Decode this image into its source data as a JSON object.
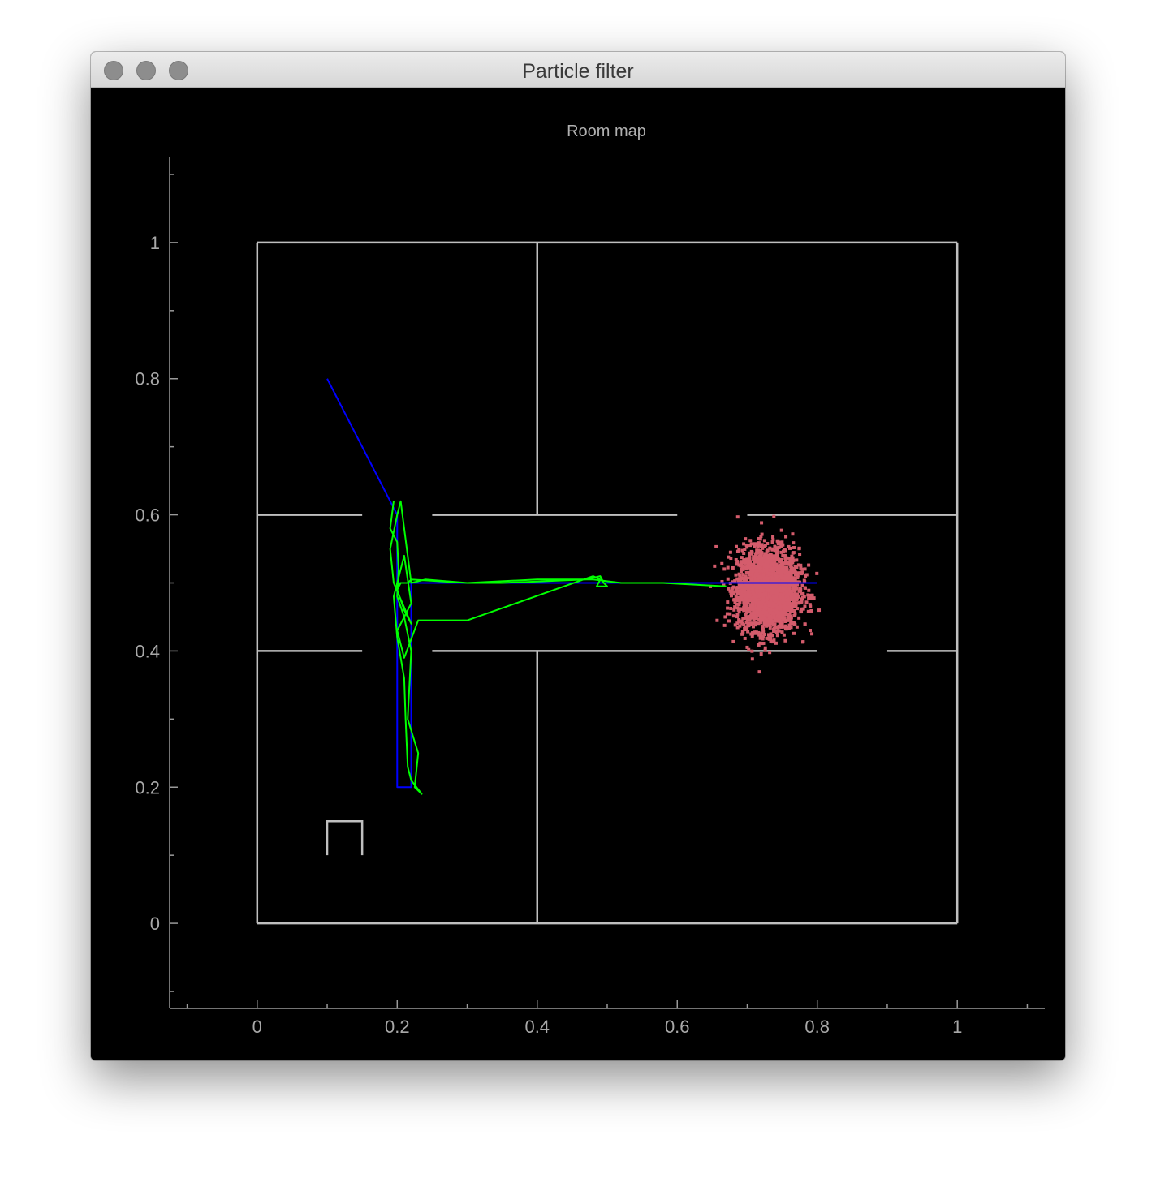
{
  "window": {
    "title": "Particle filter"
  },
  "colors": {
    "background": "#000000",
    "axis": "#9a9a9a",
    "walls": "#bfbfbf",
    "true_path": "#0000ff",
    "estimated_path": "#00ff00",
    "particles": "#d45c6c"
  },
  "chart_data": {
    "type": "line",
    "title": "Room map",
    "xlabel": "",
    "ylabel": "",
    "xlim": [
      -0.125,
      1.125
    ],
    "ylim": [
      -0.125,
      1.125
    ],
    "xticks": [
      0,
      0.2,
      0.4,
      0.6,
      0.8,
      1
    ],
    "yticks": [
      0,
      0.2,
      0.4,
      0.6,
      0.8,
      1
    ],
    "xtick_labels": [
      "0",
      "0.2",
      "0.4",
      "0.6",
      "0.8",
      "1"
    ],
    "ytick_labels": [
      "0",
      "0.2",
      "0.4",
      "0.6",
      "0.8",
      "1"
    ],
    "grid": false,
    "walls": [
      {
        "x": [
          0,
          1
        ],
        "y": [
          0,
          0
        ]
      },
      {
        "x": [
          1,
          1
        ],
        "y": [
          0,
          1
        ]
      },
      {
        "x": [
          1,
          0
        ],
        "y": [
          1,
          1
        ]
      },
      {
        "x": [
          0,
          0
        ],
        "y": [
          1,
          0
        ]
      },
      {
        "x": [
          0.4,
          0.4
        ],
        "y": [
          1,
          0.6
        ]
      },
      {
        "x": [
          0.4,
          0.4
        ],
        "y": [
          0.4,
          0
        ]
      },
      {
        "x": [
          0,
          0.15
        ],
        "y": [
          0.6,
          0.6
        ]
      },
      {
        "x": [
          0.25,
          0.6
        ],
        "y": [
          0.6,
          0.6
        ]
      },
      {
        "x": [
          0.7,
          1
        ],
        "y": [
          0.6,
          0.6
        ]
      },
      {
        "x": [
          0,
          0.15
        ],
        "y": [
          0.4,
          0.4
        ]
      },
      {
        "x": [
          0.25,
          0.8
        ],
        "y": [
          0.4,
          0.4
        ]
      },
      {
        "x": [
          0.9,
          1
        ],
        "y": [
          0.4,
          0.4
        ]
      },
      {
        "x": [
          0.1,
          0.1,
          0.15,
          0.15
        ],
        "y": [
          0.1,
          0.15,
          0.15,
          0.1
        ]
      }
    ],
    "series": [
      {
        "x": [
          0.1,
          0.2,
          0.2,
          0.22,
          0.22,
          0.2,
          0.22,
          0.49,
          0.66,
          0.8
        ],
        "y": [
          0.8,
          0.6,
          0.2,
          0.2,
          0.5,
          0.5,
          0.5,
          0.5,
          0.5,
          0.5
        ]
      },
      {
        "x": [
          0.195,
          0.19,
          0.2,
          0.202,
          0.2,
          0.21,
          0.22,
          0.215,
          0.23,
          0.225,
          0.235,
          0.22,
          0.215,
          0.212,
          0.21,
          0.2,
          0.195,
          0.21,
          0.22,
          0.2,
          0.21,
          0.23,
          0.3,
          0.48,
          0.49,
          0.485,
          0.5,
          0.495,
          0.49,
          0.47,
          0.35,
          0.3,
          0.22,
          0.215,
          0.205,
          0.2,
          0.21,
          0.22,
          0.195,
          0.19,
          0.2,
          0.205,
          0.22,
          0.24,
          0.3,
          0.4,
          0.48,
          0.52,
          0.58,
          0.67
        ],
        "y": [
          0.62,
          0.58,
          0.56,
          0.52,
          0.48,
          0.45,
          0.4,
          0.3,
          0.25,
          0.2,
          0.19,
          0.21,
          0.23,
          0.3,
          0.36,
          0.42,
          0.48,
          0.54,
          0.47,
          0.43,
          0.39,
          0.445,
          0.445,
          0.51,
          0.505,
          0.495,
          0.495,
          0.5,
          0.51,
          0.505,
          0.5,
          0.5,
          0.505,
          0.5,
          0.5,
          0.49,
          0.46,
          0.44,
          0.5,
          0.55,
          0.6,
          0.62,
          0.5,
          0.505,
          0.5,
          0.505,
          0.505,
          0.5,
          0.5,
          0.495
        ]
      }
    ],
    "particles": {
      "center": [
        0.73,
        0.49
      ],
      "spread": [
        0.022,
        0.03
      ],
      "count": 2500
    }
  }
}
